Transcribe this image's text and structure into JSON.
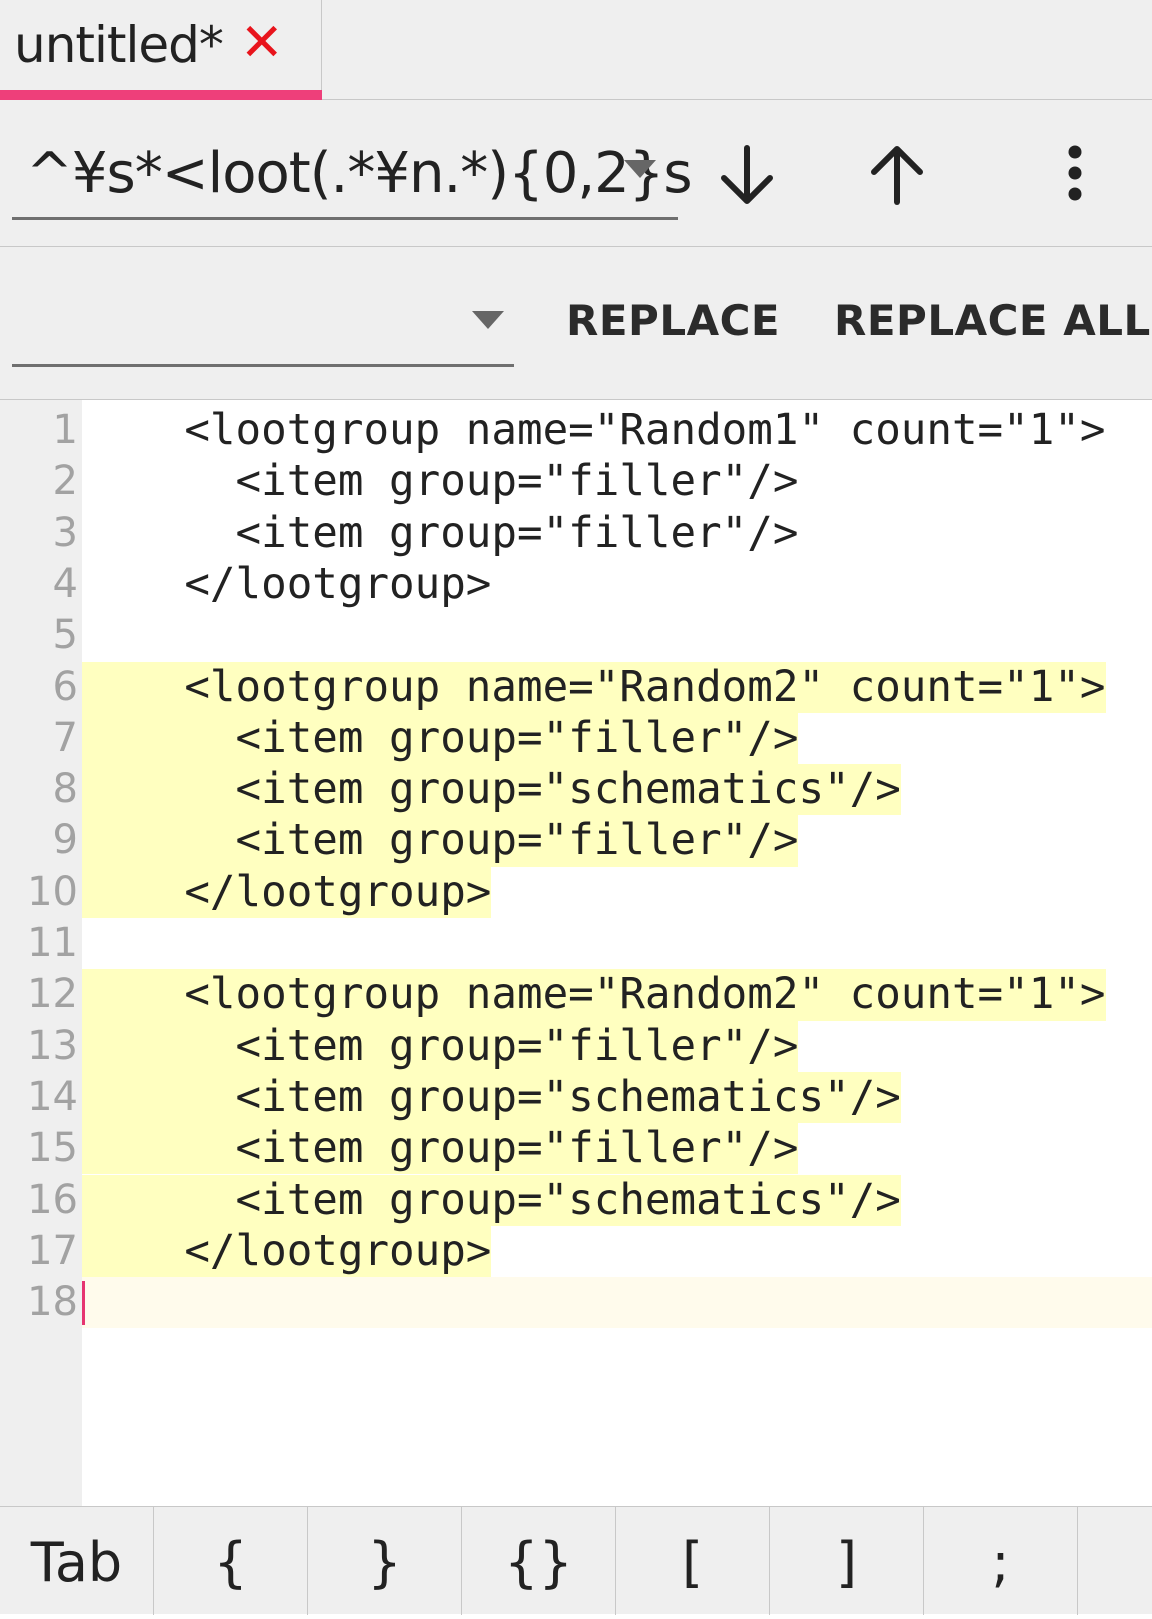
{
  "tab": {
    "title": "untitled*",
    "close_glyph": "✕",
    "close_icon": "close-icon",
    "accent": "#ee3f7a"
  },
  "search": {
    "value": "^¥s*<loot(.*¥n.*){0,2}s",
    "dropdown_icon": "dropdown-arrow-icon",
    "next_icon": "arrow-down-icon",
    "prev_icon": "arrow-up-icon",
    "menu_icon": "more-vert-icon"
  },
  "replace": {
    "value": "",
    "replace_label": "REPLACE",
    "replace_all_label": "REPLACE ALL"
  },
  "editor": {
    "highlight_color": "#ffffc0",
    "caret_color": "#e63470",
    "lines": [
      {
        "n": "1",
        "text": "    <lootgroup name=\"Random1\" count=\"1\">",
        "match": false
      },
      {
        "n": "2",
        "text": "      <item group=\"filler\"/>",
        "match": false
      },
      {
        "n": "3",
        "text": "      <item group=\"filler\"/>",
        "match": false
      },
      {
        "n": "4",
        "text": "    </lootgroup>",
        "match": false
      },
      {
        "n": "5",
        "text": "",
        "match": false
      },
      {
        "n": "6",
        "text": "    <lootgroup name=\"Random2\" count=\"1\">",
        "match": true
      },
      {
        "n": "7",
        "text": "      <item group=\"filler\"/>",
        "match": true
      },
      {
        "n": "8",
        "text": "      <item group=\"schematics\"/>",
        "match": true
      },
      {
        "n": "9",
        "text": "      <item group=\"filler\"/>",
        "match": true
      },
      {
        "n": "10",
        "text": "    </lootgroup>",
        "match": true
      },
      {
        "n": "11",
        "text": "",
        "match": false
      },
      {
        "n": "12",
        "text": "    <lootgroup name=\"Random2\" count=\"1\">",
        "match": true
      },
      {
        "n": "13",
        "text": "      <item group=\"filler\"/>",
        "match": true
      },
      {
        "n": "14",
        "text": "      <item group=\"schematics\"/>",
        "match": true
      },
      {
        "n": "15",
        "text": "      <item group=\"filler\"/>",
        "match": true
      },
      {
        "n": "16",
        "text": "      <item group=\"schematics\"/>",
        "match": true
      },
      {
        "n": "17",
        "text": "    </lootgroup>",
        "match": true
      },
      {
        "n": "18",
        "text": "",
        "match": false,
        "cursor": true
      }
    ]
  },
  "keys": [
    "Tab",
    "{",
    "}",
    "{}",
    "[",
    "]",
    ";",
    ""
  ]
}
